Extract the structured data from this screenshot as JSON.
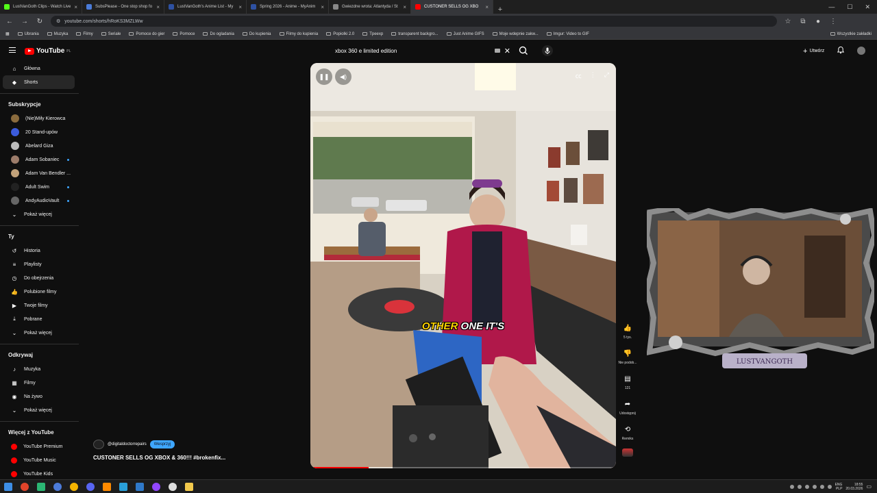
{
  "browser": {
    "tabs": [
      {
        "title": "LustVanGoth Clips - Watch Live",
        "color": "#53fc18"
      },
      {
        "title": "SubsPlease - One stop shop fo",
        "color": "#4a7bd8"
      },
      {
        "title": "LustVanGoth's Anime List - My",
        "color": "#2e51a2"
      },
      {
        "title": "Spring 2026 - Anime - MyAnim",
        "color": "#2e51a2"
      },
      {
        "title": "Gwiezdne wrota: Atlantyda / St",
        "color": "#888888"
      },
      {
        "title": "CUSTONER SELLS OG XBO",
        "color": "#ff0000",
        "active": true
      }
    ],
    "url": "youtube.com/shorts/hRoKS3MZLWw",
    "bookmarks": [
      "Ubrania",
      "Muzyka",
      "Filmy",
      "Seriale",
      "Pomoce do gier",
      "Pomoce",
      "Do ogladania",
      "Do kupienia",
      "Filmy do kupienia",
      "Popiolki 2.0",
      "Tpeexp",
      "transparent backgro...",
      "Just Anime GIFS",
      "Moje wdepnie zakw...",
      "Imgur: Video to GIF"
    ],
    "bookmarks_right": "Wszystkie zakładki"
  },
  "youtube": {
    "logo_text": "YouTube",
    "logo_region": "PL",
    "search_value": "xbox 360 e limited edition",
    "create_label": "Utwórz",
    "sidebar": {
      "main": [
        {
          "label": "Główna",
          "icon": "home-icon",
          "glyph": "⌂"
        },
        {
          "label": "Shorts",
          "icon": "shorts-icon",
          "glyph": "◆",
          "active": true
        }
      ],
      "subs_header": "Subskrypcje",
      "subscriptions": [
        {
          "label": "(Nie)Miły Kierowca",
          "color": "#8a6b3d",
          "dot": false
        },
        {
          "label": "20 Stand-upów",
          "color": "#3b5bdb",
          "dot": false
        },
        {
          "label": "Abelard Giza",
          "color": "#bbbbbb",
          "dot": false
        },
        {
          "label": "Adam Sobaniec",
          "color": "#9c7c6a",
          "dot": true
        },
        {
          "label": "Adam Van Bendler ...",
          "color": "#c2a27a",
          "dot": false
        },
        {
          "label": "Adult Swim",
          "color": "#222222",
          "dot": true
        },
        {
          "label": "AndyAudioVault",
          "color": "#666666",
          "dot": true
        }
      ],
      "show_more": "Pokaż więcej",
      "you_header": "Ty",
      "you": [
        {
          "label": "Historia",
          "glyph": "↺",
          "icon": "history-icon"
        },
        {
          "label": "Playlisty",
          "glyph": "≡",
          "icon": "playlists-icon"
        },
        {
          "label": "Do obejrzenia",
          "glyph": "◷",
          "icon": "watch-later-icon"
        },
        {
          "label": "Polubione filmy",
          "glyph": "👍",
          "icon": "liked-icon"
        },
        {
          "label": "Twoje filmy",
          "glyph": "▶",
          "icon": "your-videos-icon"
        },
        {
          "label": "Pobrane",
          "glyph": "⤓",
          "icon": "downloads-icon"
        },
        {
          "label": "Pokaż więcej",
          "glyph": "⌄",
          "icon": "chevron-down-icon"
        }
      ],
      "explore_header": "Odkrywaj",
      "explore": [
        {
          "label": "Muzyka",
          "glyph": "♪",
          "icon": "music-icon"
        },
        {
          "label": "Filmy",
          "glyph": "▦",
          "icon": "movies-icon"
        },
        {
          "label": "Na żywo",
          "glyph": "◉",
          "icon": "live-icon"
        },
        {
          "label": "Pokaż więcej",
          "glyph": "⌄",
          "icon": "chevron-down-icon"
        }
      ],
      "more_header": "Więcej z YouTube",
      "more": [
        {
          "label": "YouTube Premium",
          "icon": "yt-premium-icon"
        },
        {
          "label": "YouTube Music",
          "icon": "yt-music-icon"
        },
        {
          "label": "YouTube Kids",
          "icon": "yt-kids-icon"
        }
      ]
    },
    "short": {
      "caption_yellow": "OTHER",
      "caption_white": " ONE IT'S",
      "progress_fraction": 0.19,
      "channel": "@digitaldoctorrepairs",
      "support_label": "Wesprzyj",
      "title": "CUSTONER SELLS OG XBOX & 360!!! #brokenfix..."
    },
    "actions": [
      {
        "icon": "like-icon",
        "glyph": "👍",
        "label": "5 tys."
      },
      {
        "icon": "dislike-icon",
        "glyph": "👎",
        "label": "Nie podob..."
      },
      {
        "icon": "comments-icon",
        "glyph": "▤",
        "label": "121"
      },
      {
        "icon": "share-icon",
        "glyph": "➦",
        "label": "Udostępnij"
      },
      {
        "icon": "remix-icon",
        "glyph": "⟲",
        "label": "Remiks"
      }
    ]
  },
  "overlay": {
    "streamer_name": "LUSTVANGOTH"
  },
  "taskbar": {
    "lang": "ENG",
    "layout": "PLP",
    "time": "18:55",
    "date": "20.03.2026"
  }
}
